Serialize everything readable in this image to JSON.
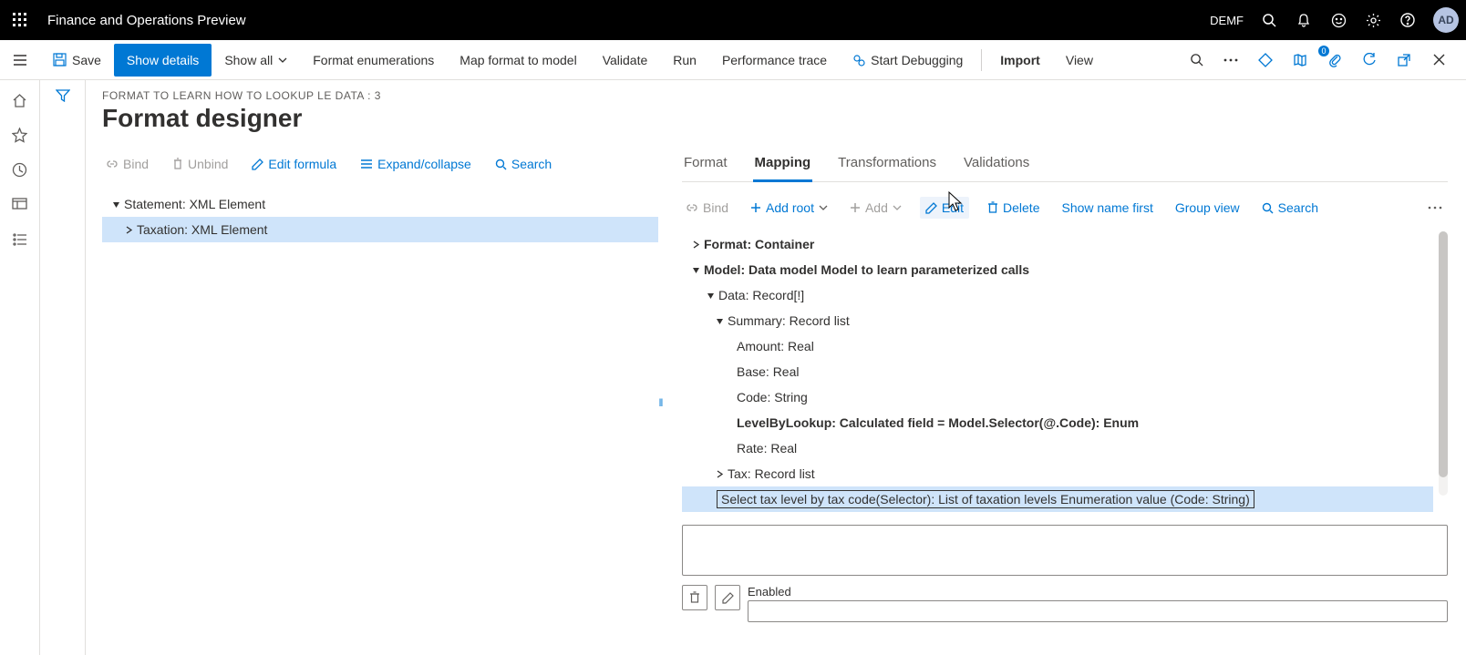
{
  "topbar": {
    "app_title": "Finance and Operations Preview",
    "company": "DEMF",
    "avatar": "AD"
  },
  "cmdbar": {
    "save": "Save",
    "show_details": "Show details",
    "show_all": "Show all",
    "format_enum": "Format enumerations",
    "map_format": "Map format to model",
    "validate": "Validate",
    "run": "Run",
    "perf_trace": "Performance trace",
    "start_debug": "Start Debugging",
    "import": "Import",
    "view": "View",
    "badge_count": "0"
  },
  "page": {
    "breadcrumb": "FORMAT TO LEARN HOW TO LOOKUP LE DATA : 3",
    "title": "Format designer"
  },
  "left_toolbar": {
    "bind": "Bind",
    "unbind": "Unbind",
    "edit_formula": "Edit formula",
    "expand": "Expand/collapse",
    "search": "Search"
  },
  "left_tree": {
    "root": "Statement: XML Element",
    "child": "Taxation: XML Element"
  },
  "tabs": {
    "format": "Format",
    "mapping": "Mapping",
    "transformations": "Transformations",
    "validations": "Validations"
  },
  "right_toolbar": {
    "bind": "Bind",
    "add_root": "Add root",
    "add": "Add",
    "edit": "Edit",
    "delete": "Delete",
    "show_name": "Show name first",
    "group_view": "Group view",
    "search": "Search"
  },
  "right_tree": {
    "format": "Format: Container",
    "model": "Model: Data model Model to learn parameterized calls",
    "data": "Data: Record[!]",
    "summary": "Summary: Record list",
    "amount": "Amount: Real",
    "base": "Base: Real",
    "code": "Code: String",
    "level": "LevelByLookup: Calculated field = Model.Selector(@.Code): Enum",
    "rate": "Rate: Real",
    "tax": "Tax: Record list",
    "selector": "Select tax level by tax code(Selector): List of taxation levels Enumeration value (Code: String)"
  },
  "enabled": {
    "label": "Enabled"
  }
}
